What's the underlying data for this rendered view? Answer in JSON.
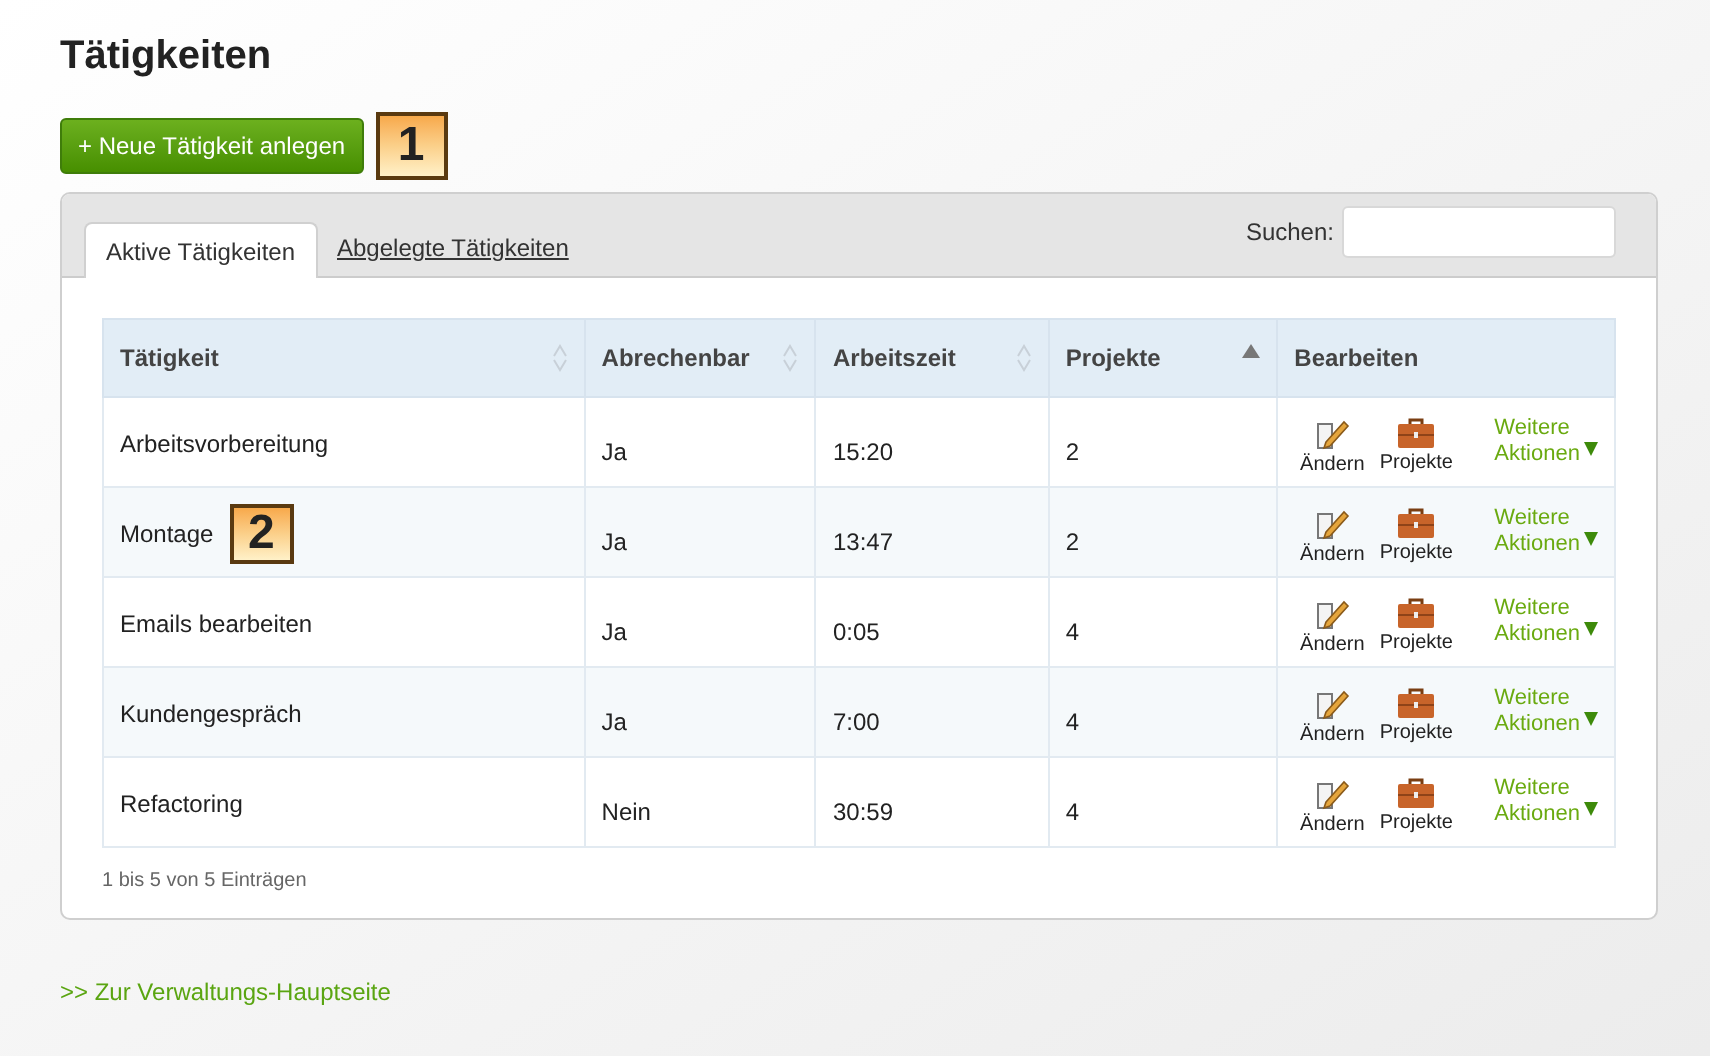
{
  "title": "Tätigkeiten",
  "new_button": {
    "label": "+ Neue Tätigkeit anlegen",
    "callout": "1"
  },
  "tabs": [
    {
      "label": "Aktive Tätigkeiten",
      "selected": true
    },
    {
      "label": "Abgelegte Tätigkeiten",
      "selected": false
    }
  ],
  "search": {
    "label": "Suchen:"
  },
  "table": {
    "columns": [
      {
        "label": "Tätigkeit",
        "sortable": true,
        "sorted": false
      },
      {
        "label": "Abrechenbar",
        "sortable": true,
        "sorted": false
      },
      {
        "label": "Arbeitszeit",
        "sortable": true,
        "sorted": false
      },
      {
        "label": "Projekte",
        "sortable": true,
        "sorted": true
      },
      {
        "label": "Bearbeiten",
        "sortable": false,
        "sorted": false
      }
    ],
    "rows": [
      {
        "name": "Arbeitsvorbereitung",
        "billable": "Ja",
        "time": "15:20",
        "projects": "2",
        "edit": "Ändern",
        "projects_action": "Projekte",
        "more": [
          "Weitere",
          "Aktionen"
        ]
      },
      {
        "name": "Montage",
        "callout": "2",
        "billable": "Ja",
        "time": "13:47",
        "projects": "2",
        "edit": "Ändern",
        "projects_action": "Projekte",
        "more": [
          "Weitere",
          "Aktionen"
        ]
      },
      {
        "name": "Emails bearbeiten",
        "billable": "Ja",
        "time": "0:05",
        "projects": "4",
        "edit": "Ändern",
        "projects_action": "Projekte",
        "more": [
          "Weitere",
          "Aktionen"
        ]
      },
      {
        "name": "Kundengespräch",
        "billable": "Ja",
        "time": "7:00",
        "projects": "4",
        "edit": "Ändern",
        "projects_action": "Projekte",
        "more": [
          "Weitere",
          "Aktionen"
        ]
      },
      {
        "name": "Refactoring",
        "billable": "Nein",
        "time": "30:59",
        "projects": "4",
        "edit": "Ändern",
        "projects_action": "Projekte",
        "more": [
          "Weitere",
          "Aktionen"
        ]
      }
    ],
    "info": "1 bis 5 von 5 Einträgen"
  },
  "back_link": ">> Zur Verwaltungs-Hauptseite"
}
